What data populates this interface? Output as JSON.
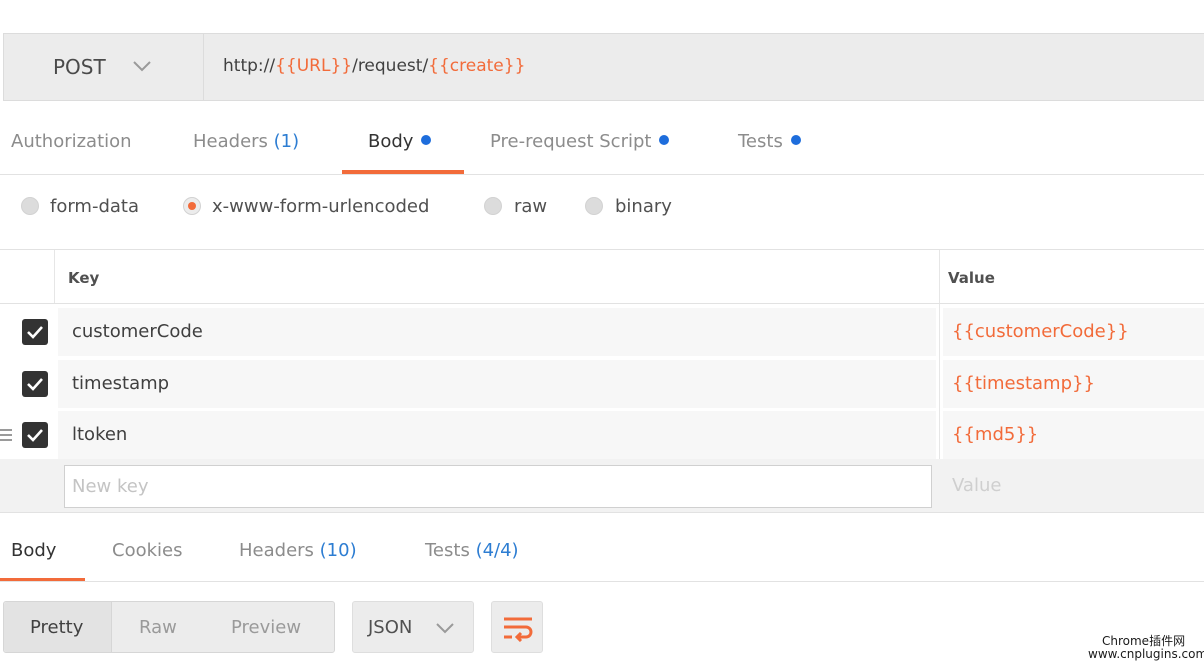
{
  "request": {
    "method": "POST",
    "url_parts": [
      {
        "text": "http://",
        "var": false
      },
      {
        "text": "{{URL}}",
        "var": true
      },
      {
        "text": "/request/",
        "var": false
      },
      {
        "text": "{{create}}",
        "var": true
      }
    ]
  },
  "request_tabs": [
    {
      "label": "Authorization",
      "count": "",
      "dot": false,
      "active": false
    },
    {
      "label": "Headers",
      "count": "(1)",
      "dot": false,
      "active": false
    },
    {
      "label": "Body",
      "count": "",
      "dot": true,
      "active": true
    },
    {
      "label": "Pre-request Script",
      "count": "",
      "dot": true,
      "active": false
    },
    {
      "label": "Tests",
      "count": "",
      "dot": true,
      "active": false
    }
  ],
  "body_types": [
    {
      "label": "form-data",
      "selected": false
    },
    {
      "label": "x-www-form-urlencoded",
      "selected": true
    },
    {
      "label": "raw",
      "selected": false
    },
    {
      "label": "binary",
      "selected": false
    }
  ],
  "params_table": {
    "key_header": "Key",
    "value_header": "Value",
    "rows": [
      {
        "checked": true,
        "key": "customerCode",
        "value": "{{customerCode}}"
      },
      {
        "checked": true,
        "key": "timestamp",
        "value": "{{timestamp}}"
      },
      {
        "checked": true,
        "key": "ltoken",
        "value": "{{md5}}"
      }
    ],
    "new_key_placeholder": "New key",
    "new_value_placeholder": "Value"
  },
  "response_tabs": [
    {
      "label": "Body",
      "count": "",
      "active": true
    },
    {
      "label": "Cookies",
      "count": "",
      "active": false
    },
    {
      "label": "Headers",
      "count": "(10)",
      "active": false
    },
    {
      "label": "Tests",
      "count": "(4/4)",
      "active": false
    }
  ],
  "response_toolbar": {
    "view_modes": [
      "Pretty",
      "Raw",
      "Preview"
    ],
    "active_view": "Pretty",
    "format": "JSON"
  },
  "watermark": {
    "line1": "Chrome插件网",
    "line2": "www.cnplugins.com"
  },
  "colors": {
    "accent": "#f26b3a",
    "count_blue": "#2d7dd2",
    "dot_blue": "#1e6ddc"
  }
}
